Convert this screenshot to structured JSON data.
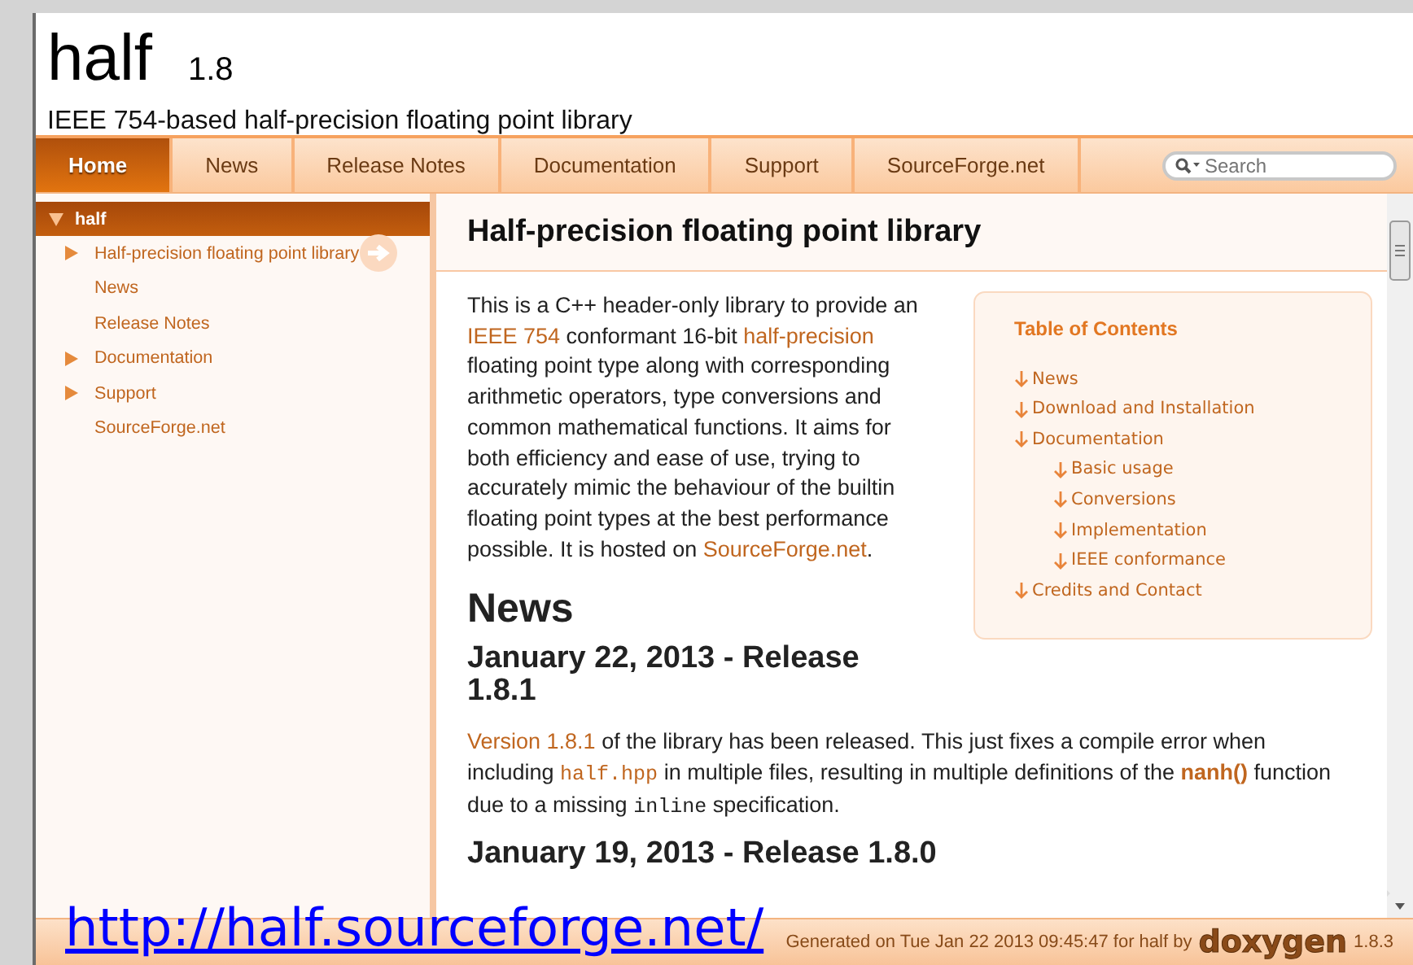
{
  "header": {
    "project_name": "half",
    "project_number": "1.8",
    "project_brief": "IEEE 754-based half-precision floating point library"
  },
  "tabs": [
    {
      "label": "Home",
      "selected": true
    },
    {
      "label": "News",
      "selected": false
    },
    {
      "label": "Release Notes",
      "selected": false
    },
    {
      "label": "Documentation",
      "selected": false
    },
    {
      "label": "Support",
      "selected": false
    },
    {
      "label": "SourceForge.net",
      "selected": false
    }
  ],
  "search": {
    "placeholder": "Search"
  },
  "sidebar": {
    "items": [
      {
        "label": "half",
        "selected": true,
        "expanded": true,
        "children": [
          {
            "label": "Half-precision floating point library",
            "selected": false,
            "expanded": false,
            "has_children": true
          },
          {
            "label": "News",
            "selected": false,
            "expanded": false,
            "has_children": false
          },
          {
            "label": "Release Notes",
            "selected": false,
            "expanded": false,
            "has_children": false
          },
          {
            "label": "Documentation",
            "selected": false,
            "expanded": false,
            "has_children": true
          },
          {
            "label": "Support",
            "selected": false,
            "expanded": false,
            "has_children": true
          },
          {
            "label": "SourceForge.net",
            "selected": false,
            "expanded": false,
            "has_children": false
          }
        ]
      }
    ]
  },
  "page_title": "Half-precision floating point library",
  "intro": [
    {
      "kind": "text",
      "text": "This is a C++ header-only library to provide an "
    },
    {
      "kind": "link",
      "text": "IEEE 754"
    },
    {
      "kind": "text",
      "text": " conformant 16-bit "
    },
    {
      "kind": "link",
      "text": "half-precision"
    },
    {
      "kind": "text",
      "text": " floating point type along with corresponding arithmetic operators, type conversions and common mathematical functions. It aims for both efficiency and ease of use, trying to accurately mimic the behaviour of the builtin floating point types at the best performance possible. It is hosted on "
    },
    {
      "kind": "link",
      "text": "SourceForge.net"
    },
    {
      "kind": "text",
      "text": "."
    }
  ],
  "toc": {
    "title": "Table of Contents",
    "items": [
      {
        "label": "News"
      },
      {
        "label": "Download and Installation"
      },
      {
        "label": "Documentation",
        "children": [
          {
            "label": "Basic usage"
          },
          {
            "label": "Conversions"
          },
          {
            "label": "Implementation"
          },
          {
            "label": "IEEE conformance"
          }
        ]
      },
      {
        "label": "Credits and Contact"
      }
    ]
  },
  "section_heading": "News",
  "releases": [
    {
      "heading": "January 22, 2013 - Release 1.8.1",
      "text": [
        {
          "kind": "link",
          "text": "Version 1.8.1"
        },
        {
          "kind": "text",
          "text": " of the library has been released. This just fixes a compile error when including "
        },
        {
          "kind": "code-link",
          "text": "half.hpp"
        },
        {
          "kind": "text",
          "text": " in multiple files, resulting in multiple definitions of the "
        },
        {
          "kind": "bold-link",
          "text": "nanh()"
        },
        {
          "kind": "text",
          "text": " function due to a missing "
        },
        {
          "kind": "code",
          "text": "inline"
        },
        {
          "kind": "text",
          "text": " specification."
        }
      ]
    },
    {
      "heading": "January 19, 2013 - Release 1.8.0"
    }
  ],
  "footer": {
    "text": "Generated on Tue Jan 22 2013 09:45:47 for half by",
    "logo": "doxygen",
    "version": "1.8.3"
  },
  "overlay_url": "http://half.sourceforge.net/"
}
